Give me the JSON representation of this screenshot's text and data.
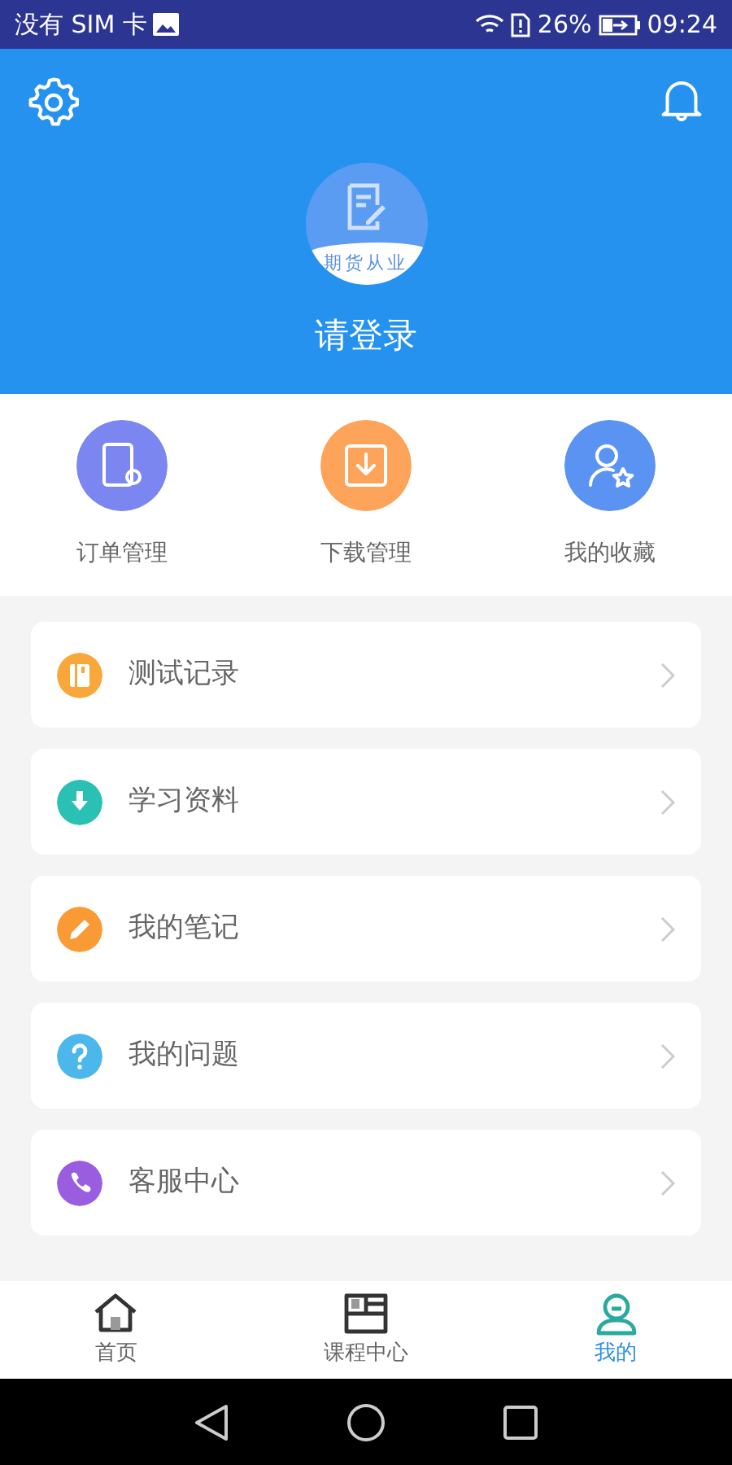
{
  "status_bar": {
    "carrier": "没有 SIM 卡",
    "battery": "26%",
    "time": "09:24"
  },
  "header": {
    "badge": "期货从业",
    "login": "请登录"
  },
  "quick_actions": [
    {
      "label": "订单管理",
      "kind": "order",
      "color": "#7b86f0"
    },
    {
      "label": "下载管理",
      "kind": "download",
      "color": "#fda45a"
    },
    {
      "label": "我的收藏",
      "kind": "favorite",
      "color": "#5b93f3"
    }
  ],
  "menu": [
    {
      "label": "测试记录",
      "kind": "book",
      "color": "#f9a73a"
    },
    {
      "label": "学习资料",
      "kind": "download",
      "color": "#2bc0b4"
    },
    {
      "label": "我的笔记",
      "kind": "pencil",
      "color": "#f99a35"
    },
    {
      "label": "我的问题",
      "kind": "question",
      "color": "#4cb7ea"
    },
    {
      "label": "客服中心",
      "kind": "phone",
      "color": "#9b5de0"
    }
  ],
  "tabs": [
    {
      "label": "首页",
      "kind": "home",
      "selected": false
    },
    {
      "label": "课程中心",
      "kind": "course",
      "selected": false
    },
    {
      "label": "我的",
      "kind": "me",
      "selected": true
    }
  ]
}
